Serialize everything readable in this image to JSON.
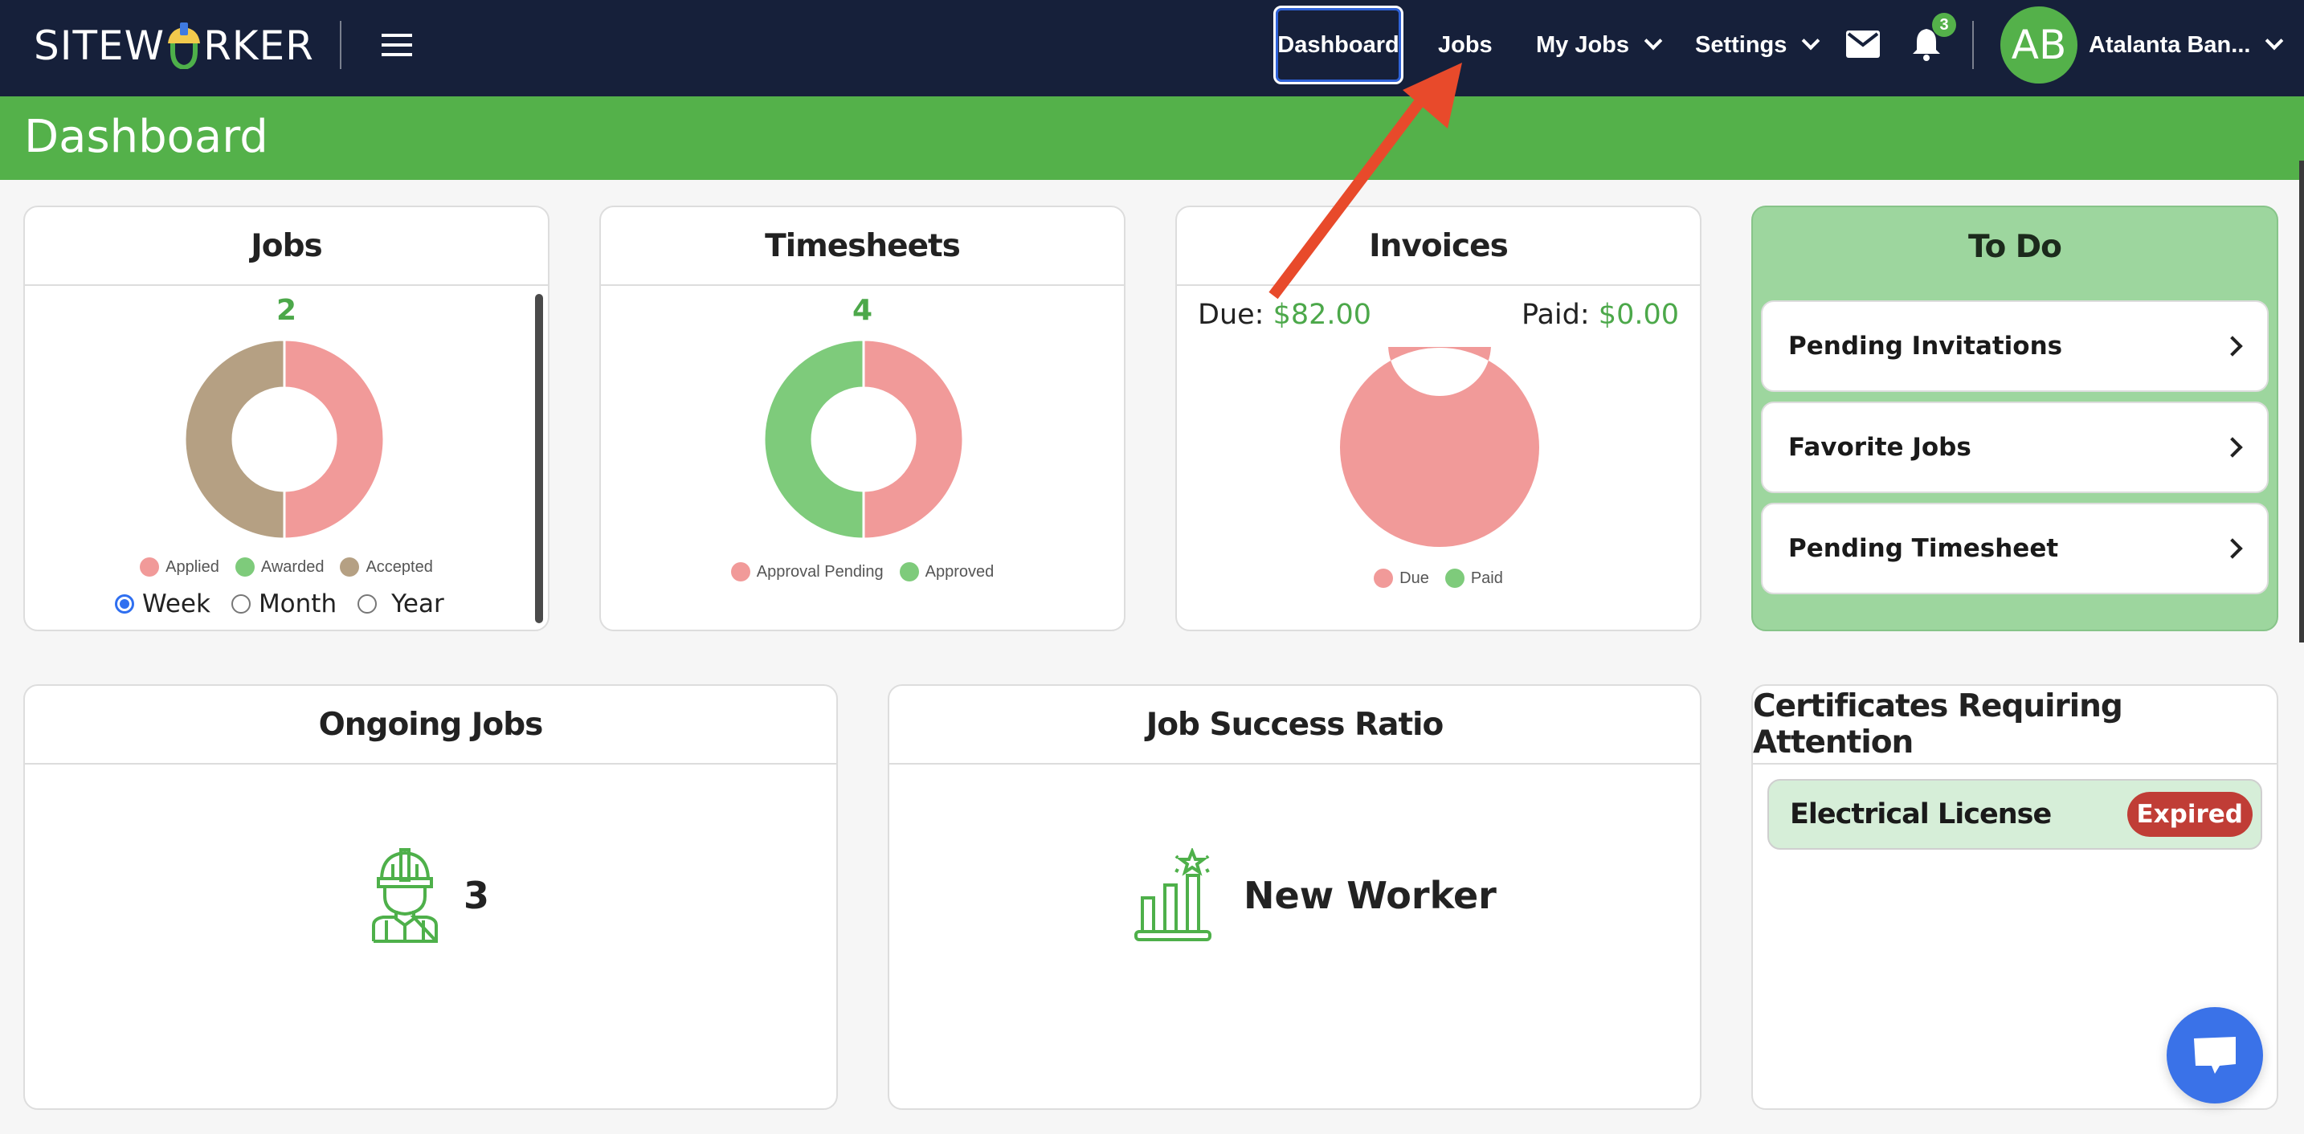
{
  "brand": {
    "logo_left": "SITEW",
    "logo_right": "RKER"
  },
  "nav": {
    "items": [
      {
        "label": "Dashboard",
        "active": true
      },
      {
        "label": "Jobs"
      },
      {
        "label": "My Jobs",
        "dropdown": true
      },
      {
        "label": "Settings",
        "dropdown": true
      }
    ],
    "notifications_count": "3",
    "user": {
      "initials": "AB",
      "name": "Atalanta Ban..."
    }
  },
  "page": {
    "title": "Dashboard"
  },
  "cards": {
    "jobs": {
      "title": "Jobs",
      "total": "2",
      "legend": [
        "Applied",
        "Awarded",
        "Accepted"
      ],
      "period_options": [
        "Week",
        "Month",
        "Year"
      ],
      "period_selected": "Week"
    },
    "timesheets": {
      "title": "Timesheets",
      "total": "4",
      "legend": [
        "Approval Pending",
        "Approved"
      ]
    },
    "invoices": {
      "title": "Invoices",
      "due_label": "Due:",
      "due_value": "$82.00",
      "paid_label": "Paid:",
      "paid_value": "$0.00",
      "legend": [
        "Due",
        "Paid"
      ]
    },
    "todo": {
      "title": "To Do",
      "items": [
        "Pending Invitations",
        "Favorite Jobs",
        "Pending Timesheet"
      ]
    },
    "ongoing_jobs": {
      "title": "Ongoing Jobs",
      "value": "3"
    },
    "job_success": {
      "title": "Job Success Ratio",
      "value": "New Worker"
    },
    "certificates": {
      "title": "Certificates Requiring Attention",
      "items": [
        {
          "name": "Electrical License",
          "status": "Expired"
        }
      ]
    }
  },
  "colors": {
    "nav_bg": "#16203a",
    "brand_green": "#54b14a",
    "applied": "#f19a99",
    "awarded": "#7ecb7b",
    "accepted": "#b5a083",
    "expired": "#c03d36",
    "chat": "#3a72e8",
    "annotation": "#e84a2b"
  },
  "chart_data": [
    {
      "type": "pie",
      "title": "Jobs",
      "categories": [
        "Applied",
        "Awarded",
        "Accepted"
      ],
      "values": [
        1,
        0,
        1
      ],
      "colors": [
        "#f19a99",
        "#7ecb7b",
        "#b5a083"
      ],
      "donut": true
    },
    {
      "type": "pie",
      "title": "Timesheets",
      "categories": [
        "Approval Pending",
        "Approved"
      ],
      "values": [
        2,
        2
      ],
      "colors": [
        "#f19a99",
        "#7ecb7b"
      ],
      "donut": true
    },
    {
      "type": "pie",
      "title": "Invoices",
      "categories": [
        "Due",
        "Paid"
      ],
      "values": [
        82.0,
        0.0
      ],
      "colors": [
        "#f19a99",
        "#7ecb7b"
      ],
      "donut": true
    }
  ]
}
